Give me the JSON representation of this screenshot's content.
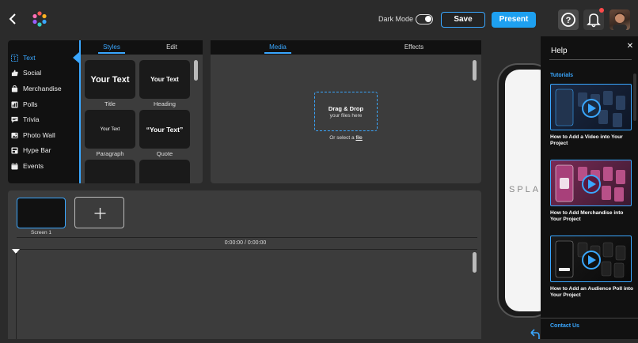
{
  "header": {
    "dark_mode_label": "Dark Mode",
    "save_label": "Save",
    "present_label": "Present"
  },
  "colors": {
    "accent": "#3aa7ff",
    "present_bg": "#1ea0f0",
    "notification_dot": "#ff4a4a"
  },
  "sidebar": {
    "items": [
      {
        "label": "Text",
        "icon": "text-icon",
        "active": true
      },
      {
        "label": "Social",
        "icon": "thumbs-up-icon"
      },
      {
        "label": "Merchandise",
        "icon": "shopping-bag-icon"
      },
      {
        "label": "Polls",
        "icon": "poll-icon"
      },
      {
        "label": "Trivia",
        "icon": "chat-icon"
      },
      {
        "label": "Photo Wall",
        "icon": "image-icon"
      },
      {
        "label": "Hype Bar",
        "icon": "bar-icon"
      },
      {
        "label": "Events",
        "icon": "calendar-icon"
      }
    ]
  },
  "styles_panel": {
    "tabs": [
      {
        "label": "Styles",
        "active": true
      },
      {
        "label": "Edit"
      }
    ],
    "cards": [
      {
        "preview": "Your Text",
        "caption": "Title"
      },
      {
        "preview": "Your Text",
        "caption": "Heading"
      },
      {
        "preview": "Your Text",
        "caption": "Paragraph"
      },
      {
        "preview": "“Your Text”",
        "caption": "Quote"
      }
    ]
  },
  "media_panel": {
    "tabs": [
      {
        "label": "Media",
        "active": true
      },
      {
        "label": "Effects"
      }
    ],
    "drop_title": "Drag & Drop",
    "drop_sub": "your files here",
    "select_prefix": "Or select a",
    "select_link": "file"
  },
  "timeline": {
    "screen_label": "Screen 1",
    "time": "0:00:00 / 0:00:00"
  },
  "preview": {
    "phone_text": "SPLA"
  },
  "help": {
    "title": "Help",
    "tutorials_label": "Tutorials",
    "tutorials": [
      {
        "title": "How to Add a Video into Your Project"
      },
      {
        "title": "How to Add Merchandise into Your Project"
      },
      {
        "title": "How to Add an Audience Poll into Your Project"
      }
    ],
    "contact": "Contact Us"
  }
}
